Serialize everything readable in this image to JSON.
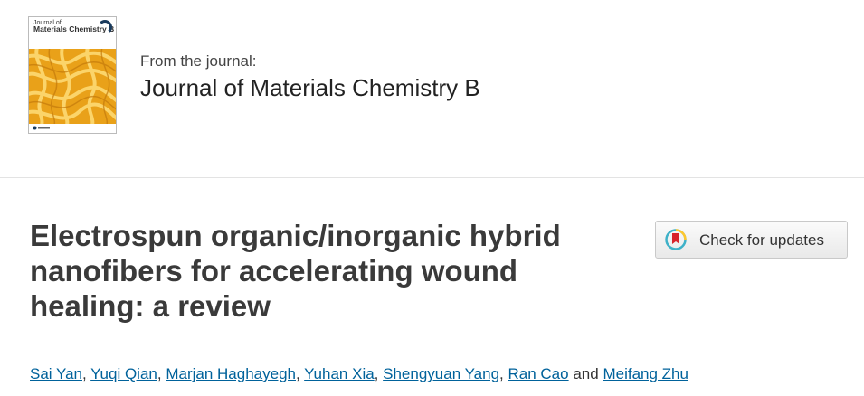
{
  "journal": {
    "from_label": "From the journal:",
    "title": "Journal of Materials Chemistry B",
    "cover": {
      "line1": "Journal of",
      "line2": "Materials Chemistry B",
      "accent": "#f2a51a"
    }
  },
  "article": {
    "title_line1": "Electrospun organic/inorganic hybrid",
    "title_line2": "nanofibers for accelerating wound",
    "title_line3": "healing: a review"
  },
  "check_updates": {
    "label": "Check for updates",
    "icon": "crossmark-icon"
  },
  "authors": {
    "names": [
      "Sai Yan",
      "Yuqi Qian",
      "Marjan Haghayegh",
      "Yuhan Xia",
      "Shengyuan Yang",
      "Ran Cao",
      "Meifang Zhu"
    ],
    "separator": ",",
    "conjunction": "and",
    "link_color": "#00629b"
  }
}
